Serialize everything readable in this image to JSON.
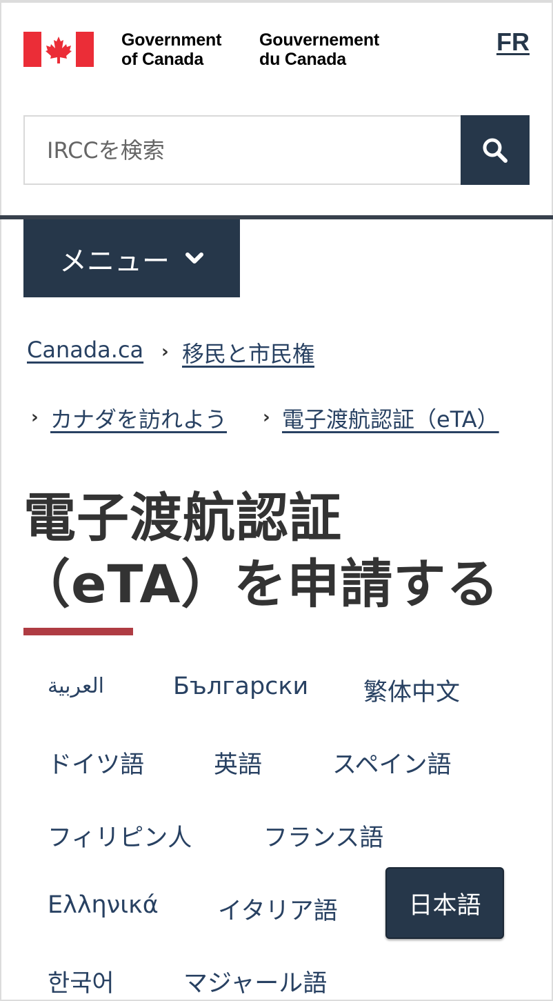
{
  "header": {
    "signature_en_line1": "Government",
    "signature_en_line2": "of Canada",
    "signature_fr_line1": "Gouvernement",
    "signature_fr_line2": "du Canada",
    "language_toggle": "FR",
    "flag_colors": {
      "red": "#eb2d37",
      "white": "#ffffff"
    }
  },
  "search": {
    "placeholder": "IRCCを検索",
    "button_icon": "search-icon"
  },
  "menu": {
    "label": "メニュー",
    "icon": "chevron-down-icon"
  },
  "breadcrumb": [
    {
      "label": "Canada.ca"
    },
    {
      "label": "移民と市民権"
    },
    {
      "label": "カナダを訪れよう"
    },
    {
      "label": "電子渡航認証（eTA）"
    }
  ],
  "page": {
    "title_line1": "電子渡航認証",
    "title_line2": "（eTA）を申請する"
  },
  "languages": [
    {
      "label": "العربية"
    },
    {
      "label": "Български"
    },
    {
      "label": "繁体中文"
    },
    {
      "label": "ドイツ語"
    },
    {
      "label": "英語"
    },
    {
      "label": "スペイン語"
    },
    {
      "label": "フィリピン人"
    },
    {
      "label": "フランス語"
    },
    {
      "label": "Ελληνικά"
    },
    {
      "label": "イタリア語"
    },
    {
      "label": "日本語",
      "active": true
    },
    {
      "label": "한국어"
    },
    {
      "label": "マジャール語"
    }
  ],
  "colors": {
    "primary": "#26374a",
    "link": "#284162",
    "accent_red": "#af3c43",
    "text": "#333333"
  }
}
